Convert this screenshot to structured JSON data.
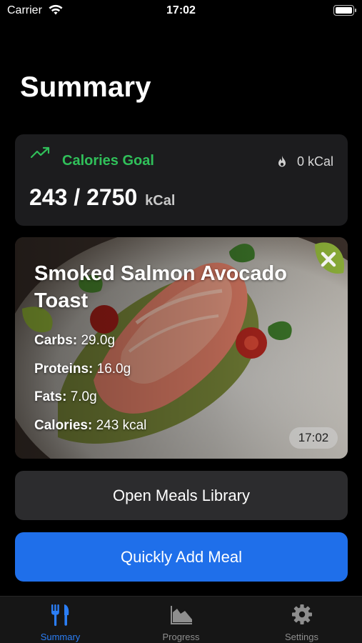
{
  "status_bar": {
    "carrier": "Carrier",
    "time": "17:02"
  },
  "header": {
    "title": "Summary"
  },
  "calories_card": {
    "goal_label": "Calories Goal",
    "burned": "0 kCal",
    "consumed_total": "243 / 2750",
    "unit": "kCal",
    "accent_color": "#30c05a"
  },
  "meal_card": {
    "title": "Smoked Salmon Avocado Toast",
    "nutrients": {
      "carbs_label": "Carbs:",
      "carbs_value": "29.0g",
      "proteins_label": "Proteins:",
      "proteins_value": "16.0g",
      "fats_label": "Fats:",
      "fats_value": "7.0g",
      "calories_label": "Calories:",
      "calories_value": "243 kcal"
    },
    "time": "17:02"
  },
  "buttons": {
    "library_label": "Open Meals Library",
    "quick_add_label": "Quickly Add Meal",
    "quick_add_color": "#1f6fea"
  },
  "tab_bar": {
    "tabs": [
      {
        "label": "Summary",
        "icon": "fork-knife-icon",
        "active": true
      },
      {
        "label": "Progress",
        "icon": "area-chart-icon",
        "active": false
      },
      {
        "label": "Settings",
        "icon": "gear-icon",
        "active": false
      }
    ],
    "active_color": "#2b7ef5"
  }
}
